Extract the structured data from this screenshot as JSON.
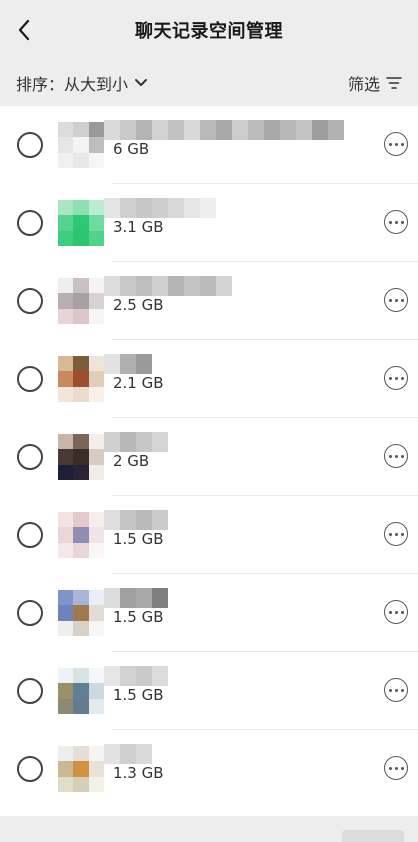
{
  "nav": {
    "title": "聊天记录空间管理"
  },
  "sort": {
    "label": "排序：从大到小",
    "filter_label": "筛选"
  },
  "items": [
    {
      "size": "6 GB"
    },
    {
      "size": "3.1 GB"
    },
    {
      "size": "2.5 GB"
    },
    {
      "size": "2.1 GB"
    },
    {
      "size": "2 GB"
    },
    {
      "size": "1.5 GB"
    },
    {
      "size": "1.5 GB"
    },
    {
      "size": "1.5 GB"
    },
    {
      "size": "1.3 GB"
    }
  ]
}
